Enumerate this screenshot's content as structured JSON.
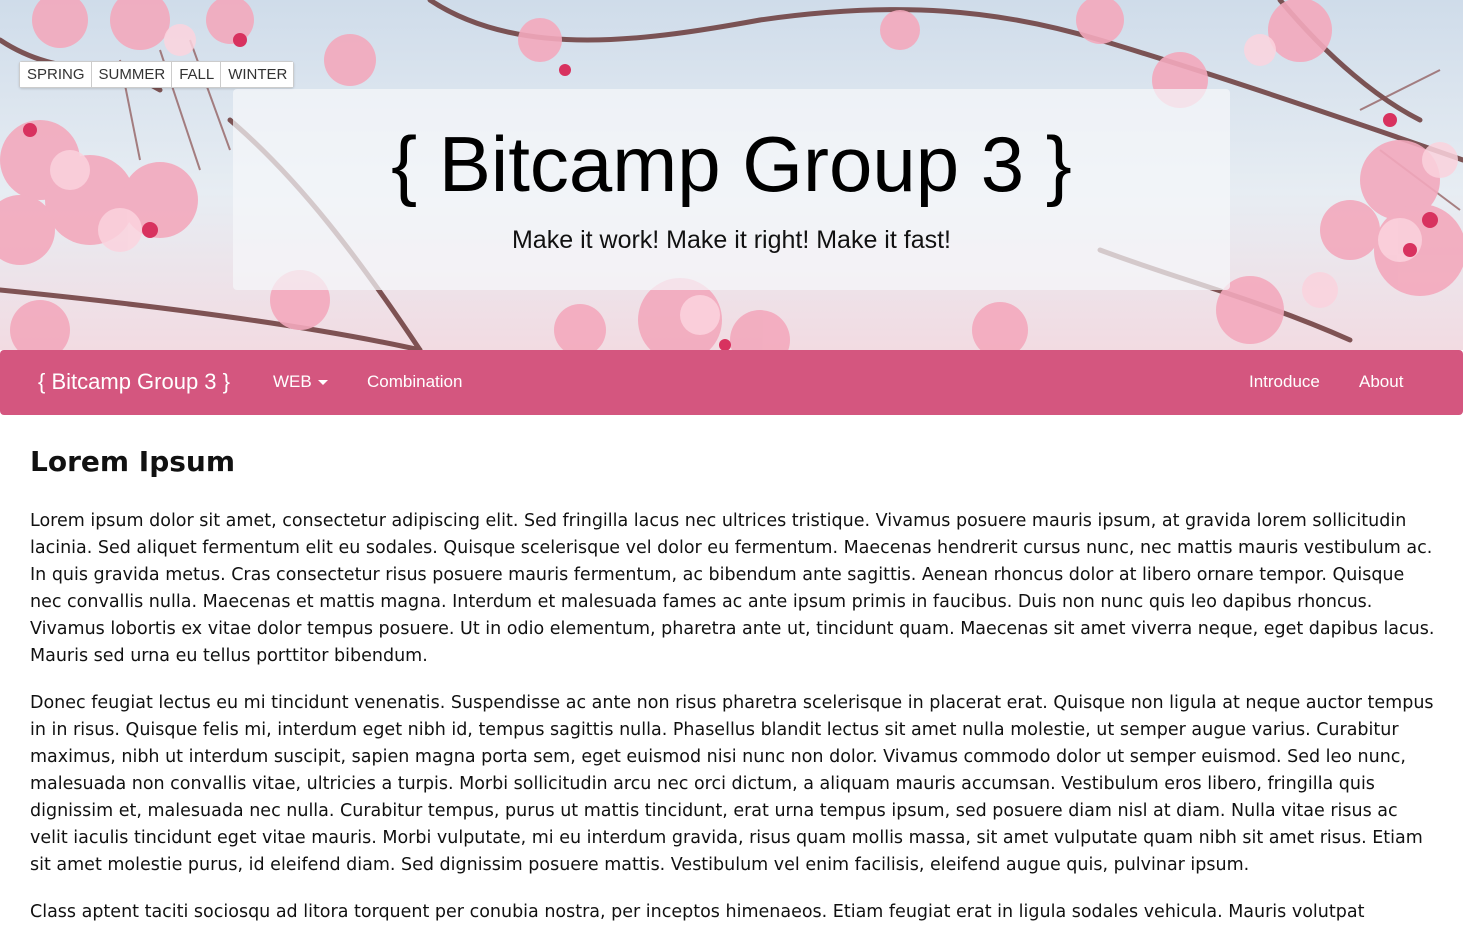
{
  "season_buttons": [
    "SPRING",
    "SUMMER",
    "FALL",
    "WINTER"
  ],
  "jumbotron": {
    "title": "{ Bitcamp Group 3 }",
    "tagline": "Make it work! Make it right! Make it fast!"
  },
  "navbar": {
    "brand": "{ Bitcamp Group 3 }",
    "left_items": [
      "WEB",
      "Combination"
    ],
    "right_items": [
      "Introduce",
      "About"
    ],
    "color": "#d4567f"
  },
  "article": {
    "heading": "Lorem Ipsum",
    "paragraphs": [
      "Lorem ipsum dolor sit amet, consectetur adipiscing elit. Sed fringilla lacus nec ultrices tristique. Vivamus posuere mauris ipsum, at gravida lorem sollicitudin lacinia. Sed aliquet fermentum elit eu sodales. Quisque scelerisque vel dolor eu fermentum. Maecenas hendrerit cursus nunc, nec mattis mauris vestibulum ac. In quis gravida metus. Cras consectetur risus posuere mauris fermentum, ac bibendum ante sagittis. Aenean rhoncus dolor at libero ornare tempor. Quisque nec convallis nulla. Maecenas et mattis magna. Interdum et malesuada fames ac ante ipsum primis in faucibus. Duis non nunc quis leo dapibus rhoncus. Vivamus lobortis ex vitae dolor tempus posuere. Ut in odio elementum, pharetra ante ut, tincidunt quam. Maecenas sit amet viverra neque, eget dapibus lacus. Mauris sed urna eu tellus porttitor bibendum.",
      "Donec feugiat lectus eu mi tincidunt venenatis. Suspendisse ac ante non risus pharetra scelerisque in placerat erat. Quisque non ligula at neque auctor tempus in in risus. Quisque felis mi, interdum eget nibh id, tempus sagittis nulla. Phasellus blandit lectus sit amet nulla molestie, ut semper augue varius. Curabitur maximus, nibh ut interdum suscipit, sapien magna porta sem, eget euismod nisi nunc non dolor. Vivamus commodo dolor ut semper euismod. Sed leo nunc, malesuada non convallis vitae, ultricies a turpis. Morbi sollicitudin arcu nec orci dictum, a aliquam mauris accumsan. Vestibulum eros libero, fringilla quis dignissim et, malesuada nec nulla. Curabitur tempus, purus ut mattis tincidunt, erat urna tempus ipsum, sed posuere diam nisl at diam. Nulla vitae risus ac velit iaculis tincidunt eget vitae mauris. Morbi vulputate, mi eu interdum gravida, risus quam mollis massa, sit amet vulputate quam nibh sit amet risus. Etiam sit amet molestie purus, id eleifend diam. Sed dignissim posuere mattis. Vestibulum vel enim facilisis, eleifend augue quis, pulvinar ipsum.",
      "Class aptent taciti sociosqu ad litora torquent per conubia nostra, per inceptos himenaeos. Etiam feugiat erat in ligula sodales vehicula. Mauris volutpat"
    ]
  }
}
